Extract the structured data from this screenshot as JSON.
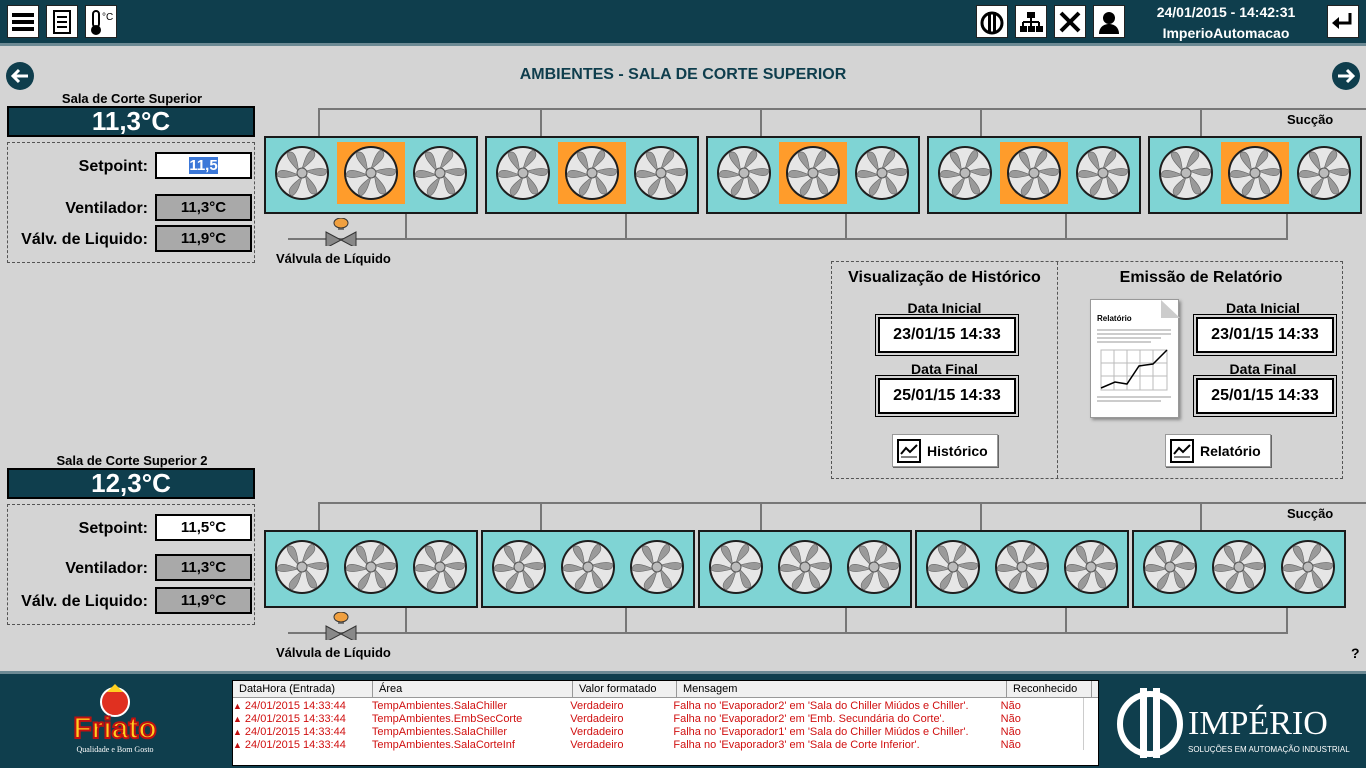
{
  "header": {
    "date_time": "24/01/2015 - 14:42:31",
    "user": "ImperioAutomacao",
    "toolbar_left": [
      "menu-icon",
      "report-icon",
      "thermometer-icon"
    ],
    "toolbar_right": [
      "imperio-logo-icon",
      "network-icon",
      "tools-icon",
      "operator-icon",
      "return-icon"
    ]
  },
  "page": {
    "title": "AMBIENTES - SALA DE CORTE SUPERIOR"
  },
  "rooms": [
    {
      "name": "Sala de Corte Superior",
      "temperature": "11,3°C",
      "setpoint_label": "Setpoint:",
      "setpoint_value": "11,5",
      "fan_label": "Ventilador:",
      "fan_value": "11,3°C",
      "valve_label": "Válv. de Liquido:",
      "valve_value": "11,9°C",
      "suction_label": "Sucção",
      "valve_caption": "Válvula de Líquido"
    },
    {
      "name": "Sala de Corte Superior 2",
      "temperature": "12,3°C",
      "setpoint_label": "Setpoint:",
      "setpoint_value": "11,5°C",
      "fan_label": "Ventilador:",
      "fan_value": "11,3°C",
      "valve_label": "Válv. de Liquido:",
      "valve_value": "11,9°C",
      "suction_label": "Sucção",
      "valve_caption": "Válvula de Líquido"
    }
  ],
  "history": {
    "title": "Visualização de Histórico",
    "start_label": "Data Inicial",
    "start_value": "23/01/15 14:33",
    "end_label": "Data Final",
    "end_value": "25/01/15 14:33",
    "button_label": "Histórico"
  },
  "report": {
    "title": "Emissão de Relatório",
    "doc_title": "Relatório",
    "start_label": "Data Inicial",
    "start_value": "23/01/15 14:33",
    "end_label": "Data Final",
    "end_value": "25/01/15 14:33",
    "button_label": "Relatório"
  },
  "help_label": "?",
  "alarms": {
    "columns": [
      "DataHora (Entrada)",
      "Área",
      "Valor formatado",
      "Mensagem",
      "Reconhecido"
    ],
    "rows": [
      [
        "24/01/2015 14:33:44",
        "TempAmbientes.SalaChiller",
        "Verdadeiro",
        "Falha no 'Evaporador2' em 'Sala do Chiller Miúdos e Chiller'.",
        "Não"
      ],
      [
        "24/01/2015 14:33:44",
        "TempAmbientes.EmbSecCorte",
        "Verdadeiro",
        "Falha no 'Evaporador2' em 'Emb. Secundária do Corte'.",
        "Não"
      ],
      [
        "24/01/2015 14:33:44",
        "TempAmbientes.SalaChiller",
        "Verdadeiro",
        "Falha no 'Evaporador1' em 'Sala do Chiller Miúdos e Chiller'.",
        "Não"
      ],
      [
        "24/01/2015 14:33:44",
        "TempAmbientes.SalaCorteInf",
        "Verdadeiro",
        "Falha no 'Evaporador3' em 'Sala de Corte Inferior'.",
        "Não"
      ]
    ]
  },
  "brand": {
    "left_logo": "Friato",
    "left_tagline": "Qualidade e Bom Gosto",
    "right_logo": "IMPÉRIO",
    "right_tagline": "SOLUÇÕES EM AUTOMAÇÃO INDUSTRIAL"
  },
  "colors": {
    "dark_teal": "#0f3e4d",
    "evaporator": "#7fd4d4",
    "fan_active": "#ff9c2b",
    "alarm_text": "#d01010"
  },
  "evaporators_row1": [
    {
      "fans": [
        false,
        true,
        false
      ]
    },
    {
      "fans": [
        false,
        true,
        false
      ]
    },
    {
      "fans": [
        false,
        true,
        false
      ]
    },
    {
      "fans": [
        false,
        true,
        false
      ]
    },
    {
      "fans": [
        false,
        true,
        false
      ]
    }
  ],
  "evaporators_row2": [
    {
      "fans": [
        false,
        false,
        false
      ]
    },
    {
      "fans": [
        false,
        false,
        false
      ]
    },
    {
      "fans": [
        false,
        false,
        false
      ]
    },
    {
      "fans": [
        false,
        false,
        false
      ]
    },
    {
      "fans": [
        false,
        false,
        false
      ]
    }
  ]
}
